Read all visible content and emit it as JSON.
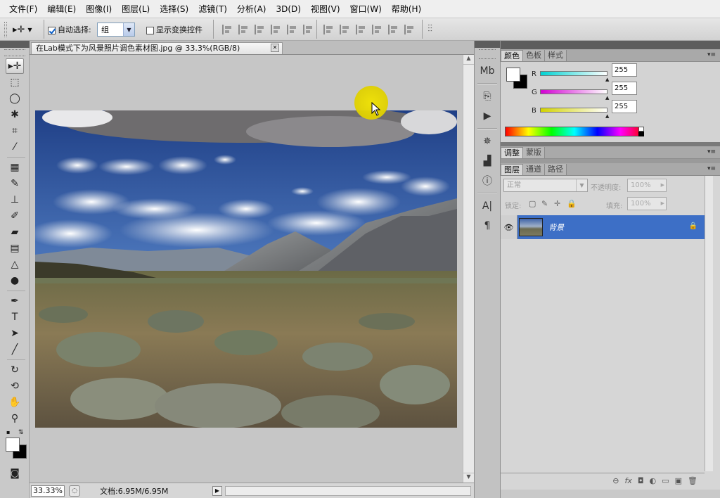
{
  "menu": [
    "文件(F)",
    "编辑(E)",
    "图像(I)",
    "图层(L)",
    "选择(S)",
    "滤镜(T)",
    "分析(A)",
    "3D(D)",
    "视图(V)",
    "窗口(W)",
    "帮助(H)"
  ],
  "options": {
    "auto_select_label": "自动选择:",
    "auto_select_checked": true,
    "auto_select_value": "组",
    "show_transform_label": "显示变换控件",
    "show_transform_checked": false
  },
  "document": {
    "tab_title": "在Lab模式下为风景照片调色素材图.jpg @ 33.3%(RGB/8)",
    "close_glyph": "✕"
  },
  "status": {
    "zoom": "33.33%",
    "doc_info": "文档:6.95M/6.95M"
  },
  "color_panel": {
    "tabs": [
      "颜色",
      "色板",
      "样式"
    ],
    "active_tab": 0,
    "channels": [
      {
        "label": "R",
        "value": "255",
        "color": "#00d2d2"
      },
      {
        "label": "G",
        "value": "255",
        "color": "#d200d2"
      },
      {
        "label": "B",
        "value": "255",
        "color": "#d2d200"
      }
    ]
  },
  "adjust_panel": {
    "tabs": [
      "调整",
      "蒙版"
    ],
    "active_tab": 0
  },
  "layers_panel": {
    "tabs": [
      "图层",
      "通道",
      "路径"
    ],
    "active_tab": 0,
    "blend_mode": "正常",
    "opacity_label": "不透明度:",
    "opacity_value": "100%",
    "lock_label": "锁定:",
    "fill_label": "填充:",
    "fill_value": "100%",
    "layers": [
      {
        "name": "背景",
        "visible": true,
        "locked": true,
        "selected": true
      }
    ],
    "footer_icons": [
      "link-icon",
      "fx-icon",
      "mask-icon",
      "adjustment-icon",
      "group-icon",
      "new-layer-icon",
      "trash-icon"
    ],
    "footer_glyphs": [
      "⊖",
      "fx",
      "◘",
      "◐",
      "▭",
      "▣",
      "🗑"
    ]
  },
  "colors": {
    "selection_blue": "#3d6fc6",
    "panel_gray": "#c9c9c9"
  }
}
